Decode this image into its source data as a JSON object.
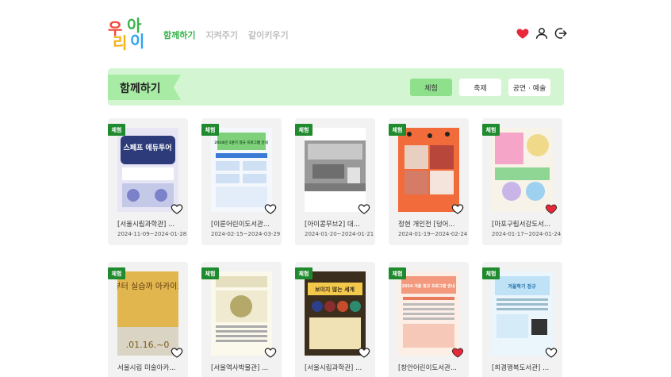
{
  "logo": {
    "text": "우리아이",
    "colors": [
      "#f04a3b",
      "#2ea3f2",
      "#f6b21b",
      "#38b249"
    ]
  },
  "nav": [
    {
      "label": "함께하기",
      "active": true
    },
    {
      "label": "지켜주기",
      "active": false
    },
    {
      "label": "같이키우기",
      "active": false
    }
  ],
  "header_icons": [
    "heart-icon",
    "user-icon",
    "logout-icon"
  ],
  "banner": {
    "title": "함께하기",
    "filters": [
      {
        "label": "체험",
        "active": true
      },
      {
        "label": "축제",
        "active": false
      },
      {
        "label": "공연 · 예술",
        "active": false
      }
    ]
  },
  "cards": [
    {
      "badge": "체험",
      "title": "[서울시립과학관] ...",
      "date": "2024-11-09~2024-01-28",
      "liked": false,
      "poster": "p-navy"
    },
    {
      "badge": "체험",
      "title": "[이룬어린이도서관...",
      "date": "2024-02-15~2024-03-29",
      "liked": false,
      "poster": "p-blue"
    },
    {
      "badge": "체험",
      "title": "[아이콩무브2] 대...",
      "date": "2024-01-20~2024-01-21",
      "liked": false,
      "poster": "p-gray"
    },
    {
      "badge": "체험",
      "title": "정현 개인전 [덩어...",
      "date": "2024-01-19~2024-02-24",
      "liked": false,
      "poster": "p-orange"
    },
    {
      "badge": "체험",
      "title": "[마포구립서강도서...",
      "date": "2024-01-17~2024-01-24",
      "liked": true,
      "poster": "p-pink"
    },
    {
      "badge": "체험",
      "title": "서울시립 미술아카...",
      "date": "",
      "liked": false,
      "poster": "p-gold"
    },
    {
      "badge": "체험",
      "title": "[서울역사박물관] ...",
      "date": "",
      "liked": false,
      "poster": "p-cream"
    },
    {
      "badge": "체험",
      "title": "[서울시립과학관] ...",
      "date": "",
      "liked": false,
      "poster": "p-darknavy"
    },
    {
      "badge": "체험",
      "title": "[창안어린이도서관...",
      "date": "",
      "liked": true,
      "poster": "p-coral"
    },
    {
      "badge": "체험",
      "title": "[희경행복도서관] ...",
      "date": "",
      "liked": false,
      "poster": "p-sky"
    }
  ],
  "poster_text": {
    "p1": "스페프 에듀투어",
    "p2": "2024년 1분기 정규 프로그램 안내",
    "p6": "부터 실습까 아카이브",
    "p6b": ".01.16.~0",
    "p8": "보이지 않는 세계",
    "p9": "2024 겨울 정규 프로그램 안내",
    "p10": "겨울학기 정규"
  }
}
